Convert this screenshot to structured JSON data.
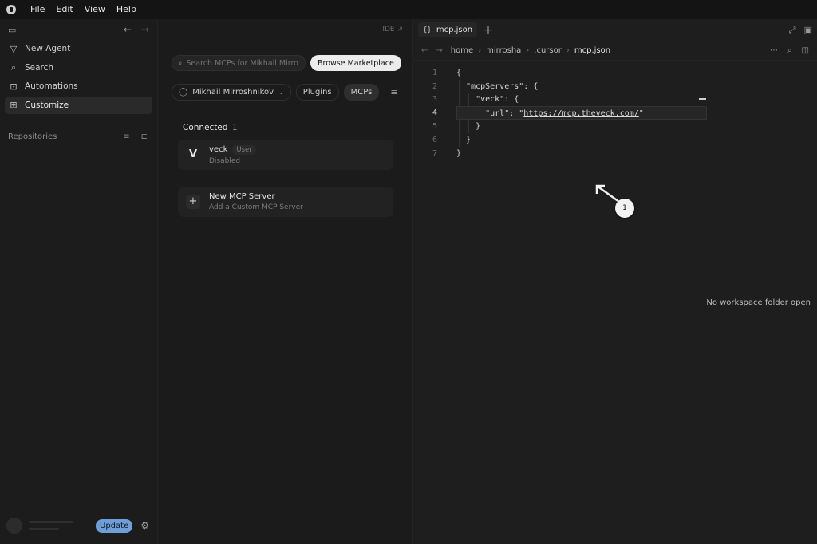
{
  "menubar": {
    "items": [
      "File",
      "Edit",
      "View",
      "Help"
    ]
  },
  "sidebar": {
    "nav": [
      {
        "label": "New Agent",
        "icon": "agent-icon"
      },
      {
        "label": "Search",
        "icon": "search-icon"
      },
      {
        "label": "Automations",
        "icon": "robot-icon"
      },
      {
        "label": "Customize",
        "icon": "grid-icon"
      }
    ],
    "repositories_label": "Repositories",
    "update_label": "Update"
  },
  "mid": {
    "ide_link": "IDE ↗",
    "search_placeholder": "Search MCPs for Mikhail Mirroshnikov",
    "browse_label": "Browse Marketplace",
    "user_filter": "Mikhail Mirroshnikov",
    "tabs": [
      "Plugins",
      "MCPs"
    ],
    "connected_label": "Connected",
    "connected_count": "1",
    "server": {
      "name": "veck",
      "badge": "User",
      "status": "Disabled"
    },
    "new_server": {
      "title": "New MCP Server",
      "subtitle": "Add a Custom MCP Server"
    }
  },
  "editor": {
    "tab_label": "mcp.json",
    "crumbs": [
      "home",
      "mirrosha",
      ".cursor",
      "mcp.json"
    ],
    "lines": [
      {
        "n": "1",
        "text": "{"
      },
      {
        "n": "2",
        "text": "  \"mcpServers\": {"
      },
      {
        "n": "3",
        "text": "    \"veck\": {"
      },
      {
        "n": "4",
        "pre": "      \"url\": \"",
        "url": "https://mcp.theveck.com/",
        "post": "\""
      },
      {
        "n": "5",
        "text": "    }"
      },
      {
        "n": "6",
        "text": "  }"
      },
      {
        "n": "7",
        "text": "}"
      }
    ],
    "current_line": "4",
    "step_badge": "1",
    "no_workspace": "No workspace folder open"
  }
}
